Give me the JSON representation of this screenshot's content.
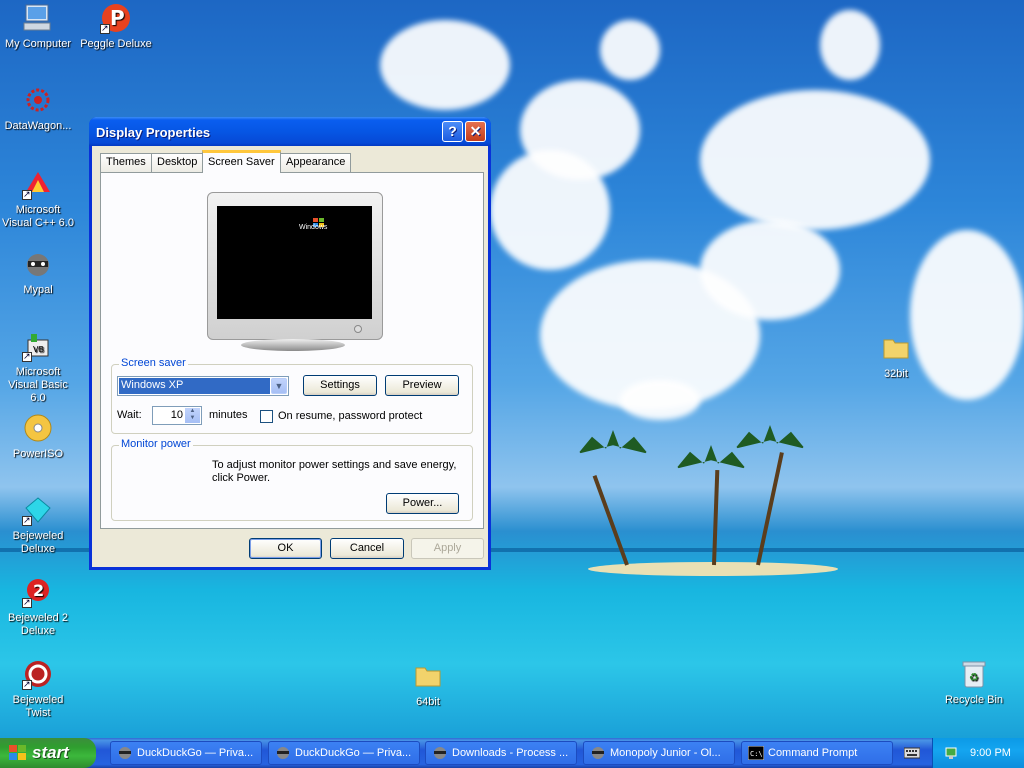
{
  "desktop": {
    "icons": [
      {
        "label": "My Computer",
        "icon": "my-computer-icon"
      },
      {
        "label": "Peggle Deluxe",
        "icon": "peggle-icon"
      },
      {
        "label": "DataWagon...",
        "icon": "datawagon-icon"
      },
      {
        "label": "Microsoft Visual C++ 6.0",
        "icon": "visual-cpp-icon"
      },
      {
        "label": "Mypal",
        "icon": "mypal-icon"
      },
      {
        "label": "Microsoft Visual Basic 6.0",
        "icon": "visual-basic-icon"
      },
      {
        "label": "PowerISO",
        "icon": "poweriso-icon"
      },
      {
        "label": "Bejeweled Deluxe",
        "icon": "bejeweled-icon"
      },
      {
        "label": "Bejeweled 2 Deluxe",
        "icon": "bejeweled2-icon"
      },
      {
        "label": "Bejeweled Twist",
        "icon": "bejeweled-twist-icon"
      },
      {
        "label": "32bit",
        "icon": "folder-icon"
      },
      {
        "label": "64bit",
        "icon": "folder-icon"
      },
      {
        "label": "Recycle Bin",
        "icon": "recycle-bin-icon"
      }
    ]
  },
  "dialog": {
    "title": "Display Properties",
    "help_label": "?",
    "close_label": "✕",
    "tabs": [
      {
        "label": "Themes"
      },
      {
        "label": "Desktop"
      },
      {
        "label": "Screen Saver",
        "active": true
      },
      {
        "label": "Appearance"
      }
    ],
    "preview_logo": "Windows",
    "screen_saver": {
      "group_label": "Screen saver",
      "selected": "Windows XP",
      "settings_label": "Settings",
      "preview_label": "Preview",
      "wait_label": "Wait:",
      "wait_value": "10",
      "minutes_label": "minutes",
      "password_label": "On resume, password protect",
      "password_checked": false
    },
    "monitor_power": {
      "group_label": "Monitor power",
      "description": "To adjust monitor power settings and save energy, click Power.",
      "power_label": "Power..."
    },
    "buttons": {
      "ok": "OK",
      "cancel": "Cancel",
      "apply": "Apply"
    }
  },
  "taskbar": {
    "start_label": "start",
    "tasks": [
      {
        "label": "DuckDuckGo — Priva..."
      },
      {
        "label": "DuckDuckGo — Priva..."
      },
      {
        "label": "Downloads - Process ..."
      },
      {
        "label": "Monopoly Junior - Ol..."
      },
      {
        "label": "Command Prompt"
      }
    ],
    "clock": "9:00 PM"
  },
  "colors": {
    "title_bar": "#0656e4",
    "start_button": "#3cb83c",
    "selection": "#316ac5",
    "group_label": "#0046d5"
  }
}
